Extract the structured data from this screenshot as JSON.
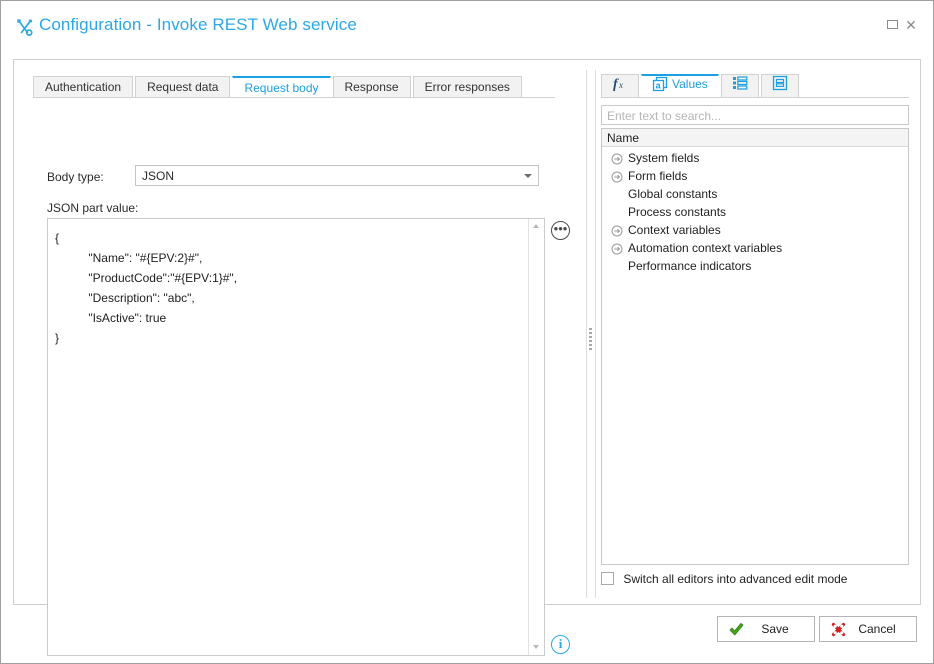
{
  "window": {
    "title": "Configuration - Invoke REST Web service",
    "title_icon": "tools-icon",
    "accent_color": "#2ca8e8",
    "controls": {
      "maximize": "maximize-icon",
      "close": "✕"
    }
  },
  "tabs": {
    "items": [
      {
        "label": "Authentication",
        "active": false
      },
      {
        "label": "Request data",
        "active": false
      },
      {
        "label": "Request body",
        "active": true
      },
      {
        "label": "Response",
        "active": false
      },
      {
        "label": "Error responses",
        "active": false
      }
    ]
  },
  "form": {
    "body_type_label": "Body type:",
    "body_type_value": "JSON",
    "body_type_options": [
      "JSON"
    ],
    "json_part_label": "JSON part value:",
    "editor_value": "{\n          \"Name\": \"#{EPV:2}#\",\n          \"ProductCode\":\"#{EPV:1}#\",\n          \"Description\": \"abc\",\n          \"IsActive\": true\n}",
    "ellipsis_button": "•••",
    "info_button": "i"
  },
  "right_panel": {
    "tabs": [
      {
        "icon": "function-fx-icon",
        "label": "",
        "active": false
      },
      {
        "icon": "values-a-icon",
        "label": "Values",
        "active": true
      },
      {
        "icon": "list-items-icon",
        "label": "",
        "active": false
      },
      {
        "icon": "document-box-icon",
        "label": "",
        "active": false
      }
    ],
    "search": {
      "placeholder": "Enter text to search...",
      "value": ""
    },
    "tree": {
      "header": "Name",
      "items": [
        {
          "label": "System fields",
          "expandable": true
        },
        {
          "label": "Form fields",
          "expandable": true
        },
        {
          "label": "Global constants",
          "expandable": false
        },
        {
          "label": "Process constants",
          "expandable": false
        },
        {
          "label": "Context variables",
          "expandable": true
        },
        {
          "label": "Automation context variables",
          "expandable": true
        },
        {
          "label": "Performance indicators",
          "expandable": false
        }
      ]
    },
    "advanced_mode": {
      "label": "Switch all editors into advanced edit mode",
      "checked": false
    }
  },
  "footer": {
    "save_label": "Save",
    "cancel_label": "Cancel",
    "save_icon_color": "#3d9b1e",
    "cancel_icon_color": "#cc2222"
  }
}
